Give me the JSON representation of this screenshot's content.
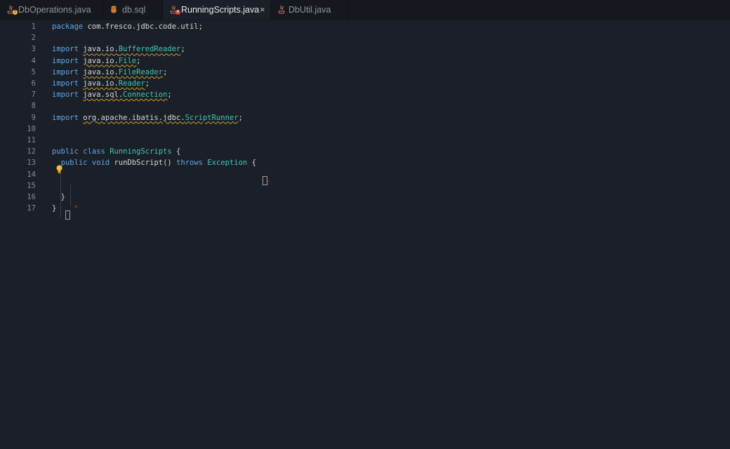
{
  "tabs": [
    {
      "label": "DbOperations.java",
      "badge": "!",
      "badge_color": "#e8b431"
    },
    {
      "label": "db.sql"
    },
    {
      "label": "RunningScripts.java",
      "badge": "×",
      "badge_color": "#e0443e",
      "close": "×"
    },
    {
      "label": "DbUtil.java"
    }
  ],
  "editor": {
    "lines": [
      {
        "n": "1",
        "segments": [
          [
            "kw",
            "package"
          ],
          [
            "",
            "com.fresco.jdbc.code.util;"
          ]
        ]
      },
      {
        "n": "2",
        "segments": []
      },
      {
        "n": "3",
        "segments": [
          [
            "kw",
            "import"
          ],
          [
            "sq",
            "java.io."
          ],
          [
            "ty sq",
            "BufferedReader"
          ],
          [
            "",
            ";"
          ]
        ]
      },
      {
        "n": "4",
        "segments": [
          [
            "kw",
            "import"
          ],
          [
            "sq",
            "java.io."
          ],
          [
            "ty sq",
            "File"
          ],
          [
            "",
            ";"
          ]
        ]
      },
      {
        "n": "5",
        "segments": [
          [
            "kw",
            "import"
          ],
          [
            "sq",
            "java.io."
          ],
          [
            "ty sq",
            "FileReader"
          ],
          [
            "",
            ";"
          ]
        ]
      },
      {
        "n": "6",
        "segments": [
          [
            "kw",
            "import"
          ],
          [
            "sq",
            "java.io."
          ],
          [
            "ty sq",
            "Reader"
          ],
          [
            "",
            ";"
          ]
        ]
      },
      {
        "n": "7",
        "segments": [
          [
            "kw",
            "import"
          ],
          [
            "sq",
            "java.sql."
          ],
          [
            "ty sq",
            "Connection"
          ],
          [
            "",
            ";"
          ]
        ]
      },
      {
        "n": "8",
        "segments": []
      },
      {
        "n": "9",
        "segments": [
          [
            "kw",
            "import"
          ],
          [
            "sq",
            "org.apache.ibatis.jdbc."
          ],
          [
            "ty sq",
            "ScriptRunner"
          ],
          [
            "",
            ";"
          ]
        ]
      },
      {
        "n": "10",
        "segments": []
      },
      {
        "n": "11",
        "segments": []
      },
      {
        "n": "12",
        "segments": [
          [
            "kw",
            "public"
          ],
          [
            "kw",
            "class"
          ],
          [
            "ty",
            "RunningScripts"
          ],
          [
            "",
            "{"
          ]
        ]
      },
      {
        "n": "13",
        "segments": [
          [
            "",
            "  "
          ],
          [
            "kw",
            "public"
          ],
          [
            "kw",
            "void"
          ],
          [
            "",
            "runDbScript()"
          ],
          [
            "kw",
            "throws"
          ],
          [
            "ty",
            "Exception"
          ],
          [
            "",
            "{"
          ]
        ]
      },
      {
        "n": "14",
        "segments": []
      },
      {
        "n": "15",
        "segments": []
      },
      {
        "n": "16",
        "segments": [
          [
            "",
            "  }"
          ]
        ]
      },
      {
        "n": "17",
        "segments": [
          [
            "",
            "}"
          ]
        ]
      }
    ]
  },
  "icons": {
    "java_file": "java-duke-icon",
    "sql_file": "database-icon",
    "lightbulb": "lightbulb-icon"
  }
}
